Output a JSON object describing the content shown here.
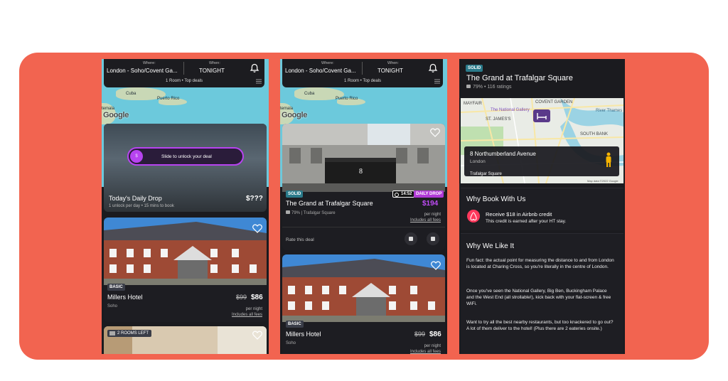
{
  "colors": {
    "stage": "#f26450",
    "accent_purple": "#b743f0",
    "solid_badge": "#2a7a8a",
    "basic_badge": "#3a3d48",
    "price_purple": "#c04cf7",
    "daily_pink": "#b03ad6"
  },
  "search": {
    "where_label": "Where:",
    "where_value": "London - Soho/Covent Ga...",
    "when_label": "When:",
    "when_value": "TONIGHT",
    "rooms": "1 Room • Top deals"
  },
  "map": {
    "labels": [
      "Cuba",
      "Puerto Rico",
      "temala"
    ],
    "google": "Google"
  },
  "daily_drop": {
    "slider_text": "Slide to unlock your deal",
    "slider_knob": "$",
    "title": "Today's Daily Drop",
    "price": "$???",
    "subtitle": "1 unlock per day • 15 mins to book"
  },
  "millers": {
    "badge": "BASIC",
    "name": "Millers Hotel",
    "area": "Soho",
    "price_old": "$99",
    "price_new": "$86",
    "per_night": "per night",
    "fees": "Includes all fees"
  },
  "rooms_left": "2 ROOMS LEFT",
  "grand": {
    "badge": "SOLID",
    "timer": "14:52",
    "daily_badge": "DAILY DROP",
    "name": "The Grand at Trafalgar Square",
    "price": "$194",
    "rating": "79%  |  Trafalgar Square",
    "per_night": "per night",
    "fees": "Includes all fees",
    "rate_label": "Rate this deal"
  },
  "detail": {
    "badge": "SOLID",
    "title": "The Grand at Trafalgar Square",
    "rating": "79% • 116 ratings",
    "map_labels": [
      "COVENT GARDEN",
      "MAYFAIR",
      "The National Gallery",
      "ST. JAMES'S",
      "River Thames",
      "SOUTH BANK"
    ],
    "address": "8 Northumberland Avenue",
    "city": "London",
    "map_footer": "Trafalgar Square",
    "map_copyright": "Map data ©2022 Google",
    "why_book_title": "Why Book With Us",
    "credit_title": "Receive $18 in Airbnb credit",
    "credit_sub": "This credit is earned after your HT stay.",
    "why_like_title": "Why We Like It",
    "para1": "Fun fact: the actual point for measuring the distance to and from London is located at Charing Cross, so you're literally in the centre of London.",
    "para2": "Once you've seen the National Gallery, Big Ben, Buckingham Palace and the West End (all strollable!), kick back with your flat-screen & free WiFi.",
    "para3": "Want to try all the best nearby restaurants, but too knackered to go out? A lot of them deliver to the hotel! (Plus there are 2 eateries onsite.)"
  }
}
